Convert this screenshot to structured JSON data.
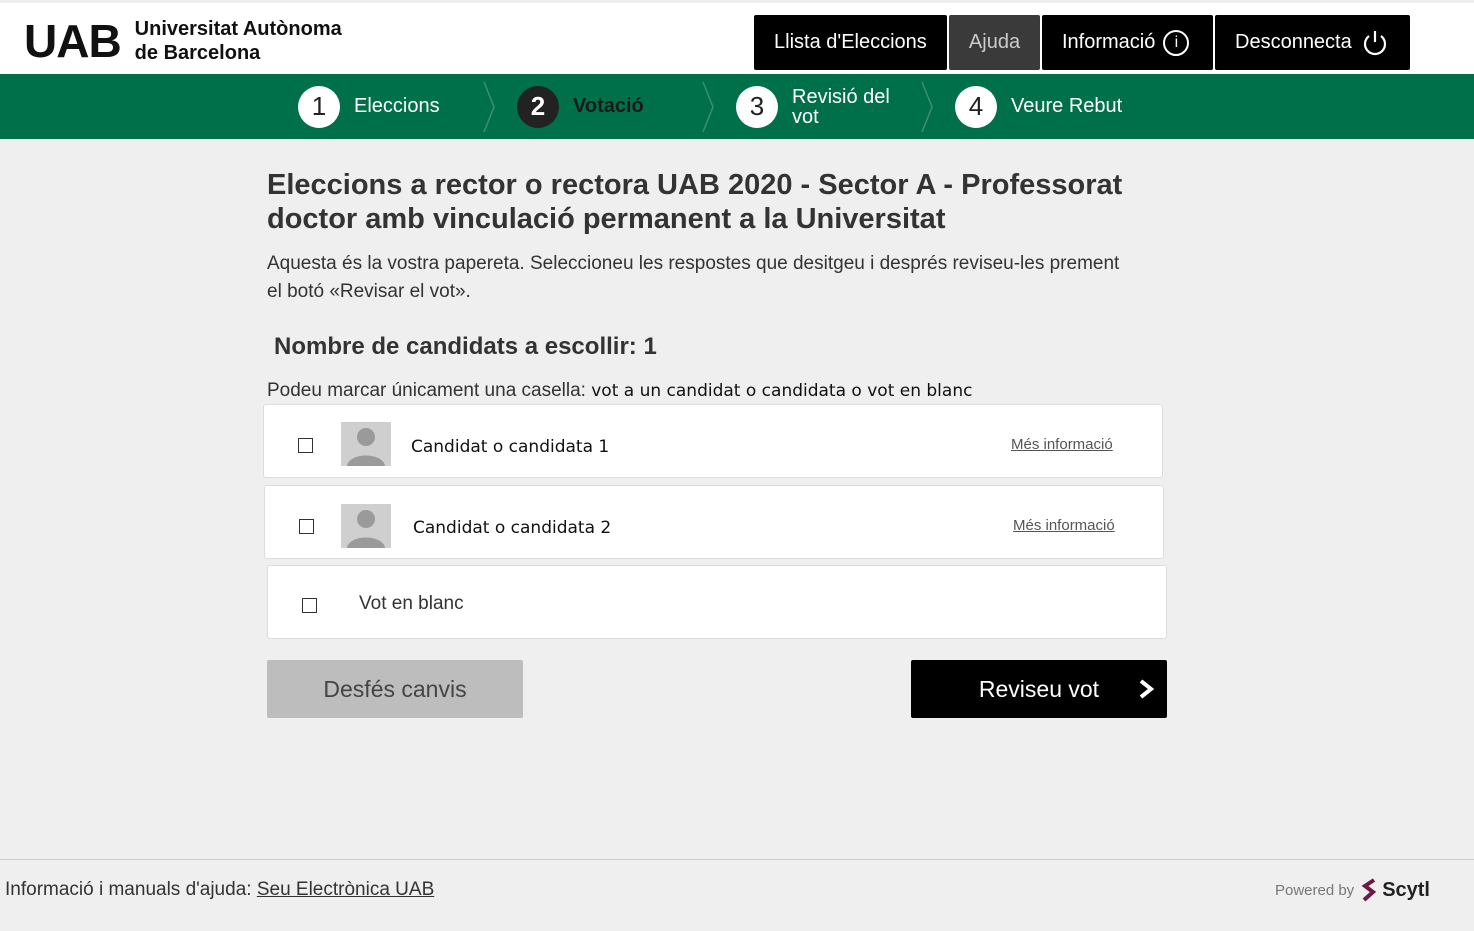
{
  "header": {
    "logo_mark": "UAB",
    "logo_line1": "Universitat Autònoma",
    "logo_line2": "de Barcelona",
    "nav": {
      "elections": "Llista d'Eleccions",
      "help": "Ajuda",
      "info": "Informació",
      "logout": "Desconnecta"
    }
  },
  "steps": [
    {
      "num": "1",
      "label": "Eleccions"
    },
    {
      "num": "2",
      "label": "Votació"
    },
    {
      "num": "3",
      "label_line1": "Revisió del",
      "label_line2": "vot"
    },
    {
      "num": "4",
      "label": "Veure Rebut"
    }
  ],
  "main": {
    "title_line1": "Eleccions a rector o rectora UAB 2020 - Sector A - Professorat",
    "title_line2": "doctor amb vinculació permanent a la Universitat",
    "intro_line1": "Aquesta és la vostra papereta. Seleccioneu les respostes que desitgeu i després reviseu-les prement",
    "intro_line2": "el botó «Revisar el vot».",
    "count": "Nombre de candidats a escollir: 1",
    "instr_a": "Podeu marcar únicament una casella: ",
    "instr_b": "vot a un candidat o candidata o vot en blanc",
    "candidates": [
      {
        "name": "Candidat o candidata 1",
        "more": "Més informació"
      },
      {
        "name": "Candidat o candidata 2",
        "more": "Més informació"
      }
    ],
    "blank_vote": "Vot en blanc",
    "undo_button": "Desfés canvis",
    "review_button": "Reviseu vot"
  },
  "footer": {
    "text": "Informació i manuals d'ajuda: ",
    "link": "Seu Electrònica UAB",
    "powered": "Powered by",
    "brand": "Scytl"
  },
  "colors": {
    "brand_green": "#00704a",
    "nav_bg": "#000000"
  }
}
